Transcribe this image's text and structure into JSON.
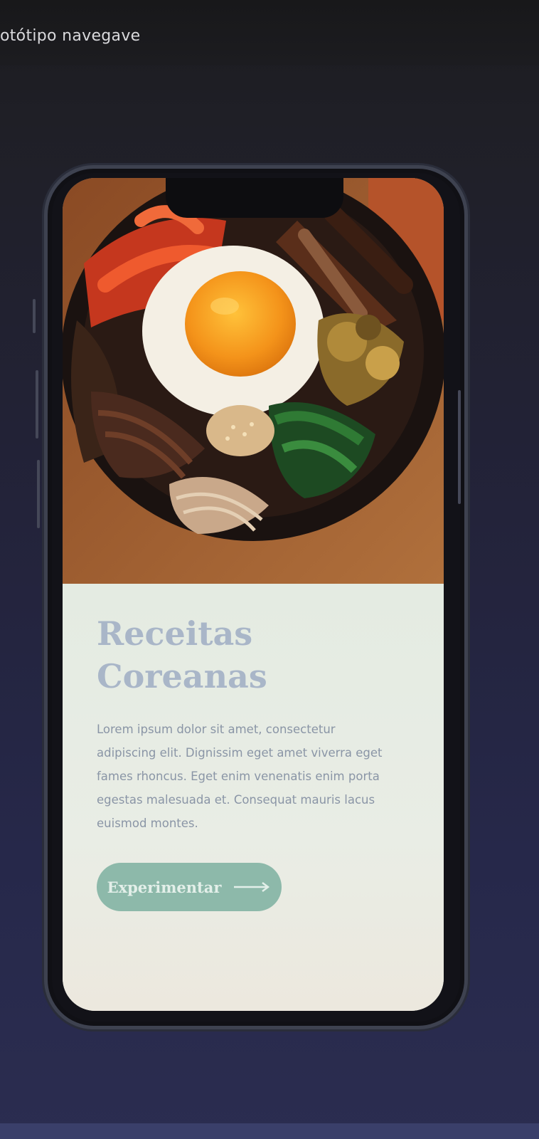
{
  "window": {
    "title": "otótipo navegave"
  },
  "recipe": {
    "title_line1": "Receitas",
    "title_line2": "Coreanas",
    "description": "Lorem ipsum dolor sit amet, consectetur adipiscing elit. Dignissim eget amet viverra eget fames rhoncus. Eget enim venenatis enim porta egestas malesuada et. Consequat mauris lacus euismod montes.",
    "button_label": "Experimentar",
    "button_icon": "arrow-right-icon",
    "hero_image": "bibimbap-bowl-photo"
  },
  "colors": {
    "title": "#a9b6c8",
    "body_text": "#8a95a6",
    "button_bg": "#8db9aa",
    "button_text": "#e3efe9",
    "card_bg": "#e9ede5"
  }
}
